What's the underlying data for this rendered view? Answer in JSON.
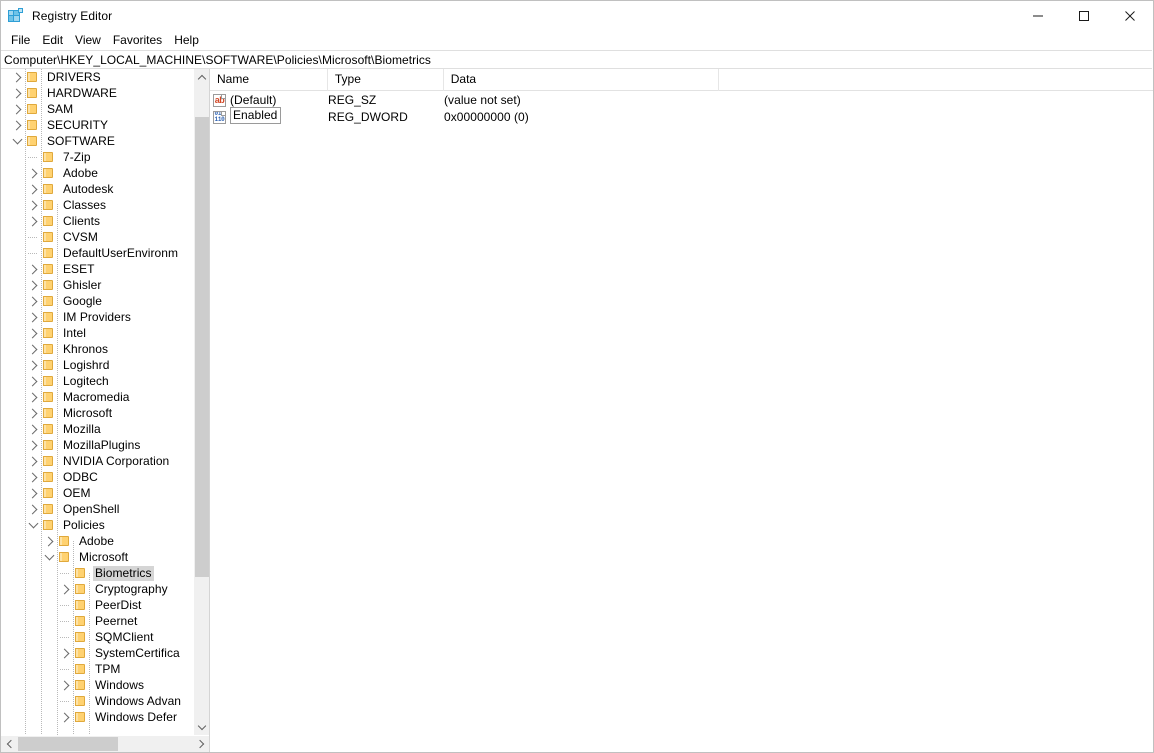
{
  "window": {
    "title": "Registry Editor",
    "icon": "registry-editor-icon",
    "controls": {
      "minimize": "minimize-icon",
      "maximize": "maximize-icon",
      "close": "close-icon"
    }
  },
  "menubar": {
    "items": [
      {
        "label": "File"
      },
      {
        "label": "Edit"
      },
      {
        "label": "View"
      },
      {
        "label": "Favorites"
      },
      {
        "label": "Help"
      }
    ]
  },
  "address": {
    "path": "Computer\\HKEY_LOCAL_MACHINE\\SOFTWARE\\Policies\\Microsoft\\Biometrics"
  },
  "tree": {
    "items": [
      {
        "label": "DRIVERS",
        "depth": 1,
        "state": "collapsed",
        "selected": false
      },
      {
        "label": "HARDWARE",
        "depth": 1,
        "state": "collapsed",
        "selected": false
      },
      {
        "label": "SAM",
        "depth": 1,
        "state": "collapsed",
        "selected": false
      },
      {
        "label": "SECURITY",
        "depth": 1,
        "state": "collapsed",
        "selected": false
      },
      {
        "label": "SOFTWARE",
        "depth": 1,
        "state": "expanded",
        "selected": false
      },
      {
        "label": "7-Zip",
        "depth": 2,
        "state": "leaf",
        "selected": false
      },
      {
        "label": "Adobe",
        "depth": 2,
        "state": "collapsed",
        "selected": false
      },
      {
        "label": "Autodesk",
        "depth": 2,
        "state": "collapsed",
        "selected": false
      },
      {
        "label": "Classes",
        "depth": 2,
        "state": "collapsed",
        "selected": false
      },
      {
        "label": "Clients",
        "depth": 2,
        "state": "collapsed",
        "selected": false
      },
      {
        "label": "CVSM",
        "depth": 2,
        "state": "leaf",
        "selected": false
      },
      {
        "label": "DefaultUserEnvironm",
        "depth": 2,
        "state": "leaf",
        "selected": false
      },
      {
        "label": "ESET",
        "depth": 2,
        "state": "collapsed",
        "selected": false
      },
      {
        "label": "Ghisler",
        "depth": 2,
        "state": "collapsed",
        "selected": false
      },
      {
        "label": "Google",
        "depth": 2,
        "state": "collapsed",
        "selected": false
      },
      {
        "label": "IM Providers",
        "depth": 2,
        "state": "collapsed",
        "selected": false
      },
      {
        "label": "Intel",
        "depth": 2,
        "state": "collapsed",
        "selected": false
      },
      {
        "label": "Khronos",
        "depth": 2,
        "state": "collapsed",
        "selected": false
      },
      {
        "label": "Logishrd",
        "depth": 2,
        "state": "collapsed",
        "selected": false
      },
      {
        "label": "Logitech",
        "depth": 2,
        "state": "collapsed",
        "selected": false
      },
      {
        "label": "Macromedia",
        "depth": 2,
        "state": "collapsed",
        "selected": false
      },
      {
        "label": "Microsoft",
        "depth": 2,
        "state": "collapsed",
        "selected": false
      },
      {
        "label": "Mozilla",
        "depth": 2,
        "state": "collapsed",
        "selected": false
      },
      {
        "label": "MozillaPlugins",
        "depth": 2,
        "state": "collapsed",
        "selected": false
      },
      {
        "label": "NVIDIA Corporation",
        "depth": 2,
        "state": "collapsed",
        "selected": false
      },
      {
        "label": "ODBC",
        "depth": 2,
        "state": "collapsed",
        "selected": false
      },
      {
        "label": "OEM",
        "depth": 2,
        "state": "collapsed",
        "selected": false
      },
      {
        "label": "OpenShell",
        "depth": 2,
        "state": "collapsed",
        "selected": false
      },
      {
        "label": "Policies",
        "depth": 2,
        "state": "expanded",
        "selected": false
      },
      {
        "label": "Adobe",
        "depth": 3,
        "state": "collapsed",
        "selected": false
      },
      {
        "label": "Microsoft",
        "depth": 3,
        "state": "expanded",
        "selected": false
      },
      {
        "label": "Biometrics",
        "depth": 4,
        "state": "leaf",
        "selected": true
      },
      {
        "label": "Cryptography",
        "depth": 4,
        "state": "collapsed",
        "selected": false
      },
      {
        "label": "PeerDist",
        "depth": 4,
        "state": "leaf",
        "selected": false
      },
      {
        "label": "Peernet",
        "depth": 4,
        "state": "leaf",
        "selected": false
      },
      {
        "label": "SQMClient",
        "depth": 4,
        "state": "leaf",
        "selected": false
      },
      {
        "label": "SystemCertifica",
        "depth": 4,
        "state": "collapsed",
        "selected": false
      },
      {
        "label": "TPM",
        "depth": 4,
        "state": "leaf",
        "selected": false
      },
      {
        "label": "Windows",
        "depth": 4,
        "state": "collapsed",
        "selected": false
      },
      {
        "label": "Windows Advan",
        "depth": 4,
        "state": "leaf",
        "selected": false
      },
      {
        "label": "Windows Defer",
        "depth": 4,
        "state": "collapsed",
        "selected": false
      }
    ]
  },
  "values": {
    "columns": [
      {
        "label": "Name"
      },
      {
        "label": "Type"
      },
      {
        "label": "Data"
      },
      {
        "label": ""
      }
    ],
    "rows": [
      {
        "icon": "reg-string-icon",
        "icon_text": "ab",
        "name": "(Default)",
        "type": "REG_SZ",
        "data": "(value not set)",
        "editing": false
      },
      {
        "icon": "reg-dword-icon",
        "icon_text_top": "011",
        "icon_text_bottom": "110",
        "name": "Enabled",
        "type": "REG_DWORD",
        "data": "0x00000000 (0)",
        "editing": true
      }
    ]
  },
  "scrollbars": {
    "tree_vertical": {
      "up": "scroll-up-icon",
      "down": "scroll-down-icon"
    },
    "tree_horizontal": {
      "left": "scroll-left-icon",
      "right": "scroll-right-icon"
    }
  },
  "colors": {
    "folder": "#ffd271",
    "folder_border": "#e0a93c",
    "selection": "#d5d5d5",
    "scrollbar_track": "#f0f0f0",
    "scrollbar_thumb": "#cdcdcd",
    "reg_sz_icon": "#d24726",
    "reg_dword_icon": "#2b5fb0",
    "app_icon": "#2f9fd6"
  }
}
